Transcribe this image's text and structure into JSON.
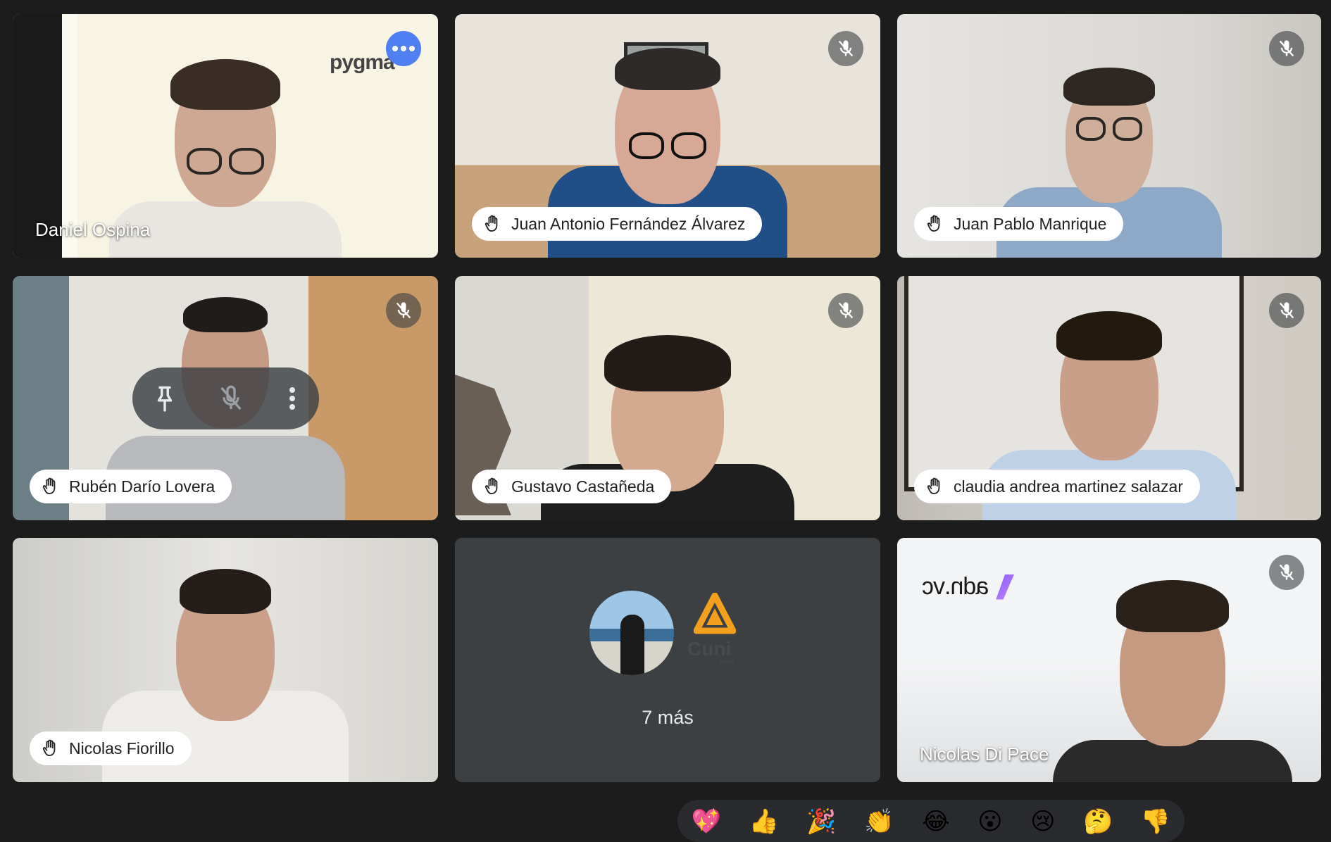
{
  "participants": [
    {
      "name": "Daniel Ospina",
      "logo": "pygma"
    },
    {
      "name": "Juan Antonio Fernández Álvarez"
    },
    {
      "name": "Juan Pablo Manrique"
    },
    {
      "name": "Rubén Darío Lovera"
    },
    {
      "name": "Gustavo Castañeda"
    },
    {
      "name": "claudia andrea martinez salazar"
    },
    {
      "name": "Nicolas Fiorillo"
    },
    {
      "name": "Nicolas Di Pace",
      "logo": "adn.vc"
    }
  ],
  "overflow": {
    "label": "7 más",
    "logo_text": "Cuni",
    "logo_subtext": "Metal"
  },
  "colors": {
    "speaking_border": "#8ab4f8",
    "more_button": "#4f7ff0",
    "tile_bg": "#3c4043"
  },
  "reactions": [
    "💖",
    "👍",
    "🎉",
    "👏",
    "😂",
    "😮",
    "😢",
    "🤔",
    "👎"
  ]
}
